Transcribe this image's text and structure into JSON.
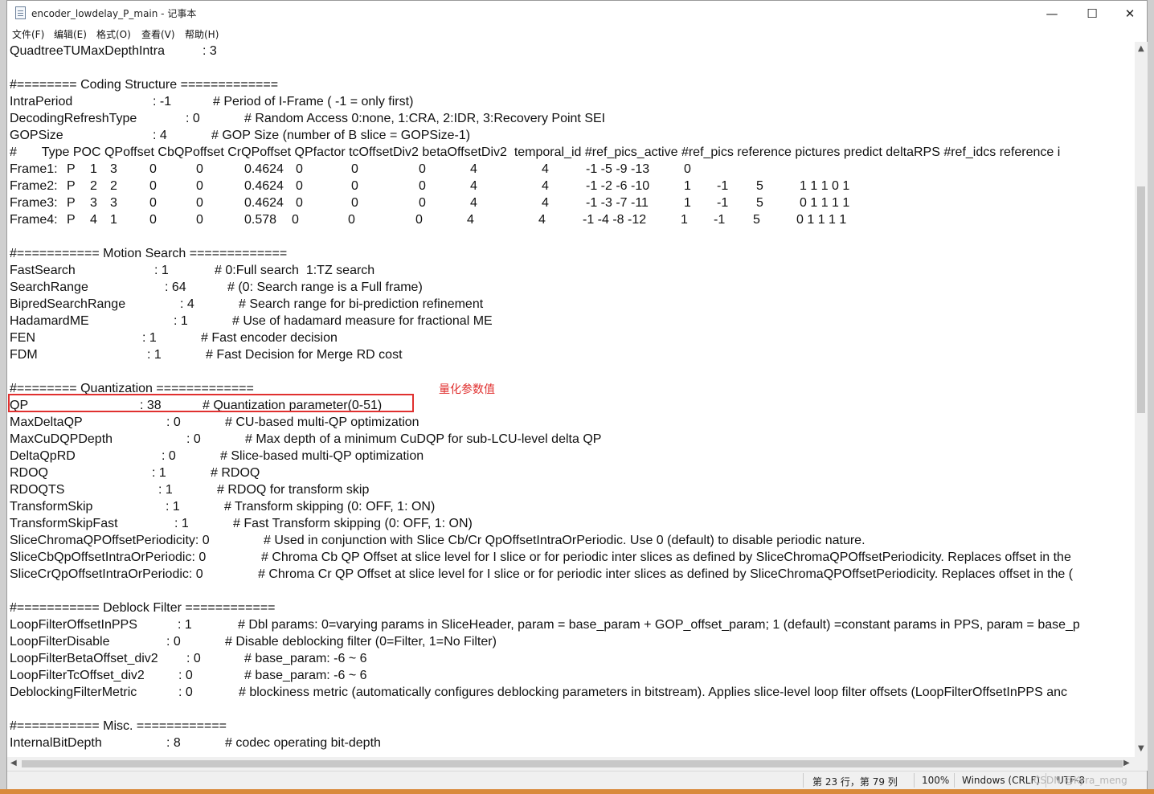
{
  "window": {
    "title": "encoder_lowdelay_P_main - 记事本",
    "minimize_glyph": "—",
    "maximize_glyph": "☐",
    "close_glyph": "✕"
  },
  "menu": [
    "文件(F)",
    "编辑(E)",
    "格式(O)",
    "查看(V)",
    "帮助(H)"
  ],
  "annotation": {
    "text": "量化参数值",
    "color": "#e0302f"
  },
  "lines": [
    [
      [
        0,
        "QuadtreeTUMaxDepthIntra"
      ],
      [
        240,
        ": 3"
      ]
    ],
    [],
    [
      [
        0,
        "#======== Coding Structure ============="
      ]
    ],
    [
      [
        0,
        "IntraPeriod"
      ],
      [
        178,
        ": -1"
      ],
      [
        253,
        "# Period of I-Frame ( -1 = only first)"
      ]
    ],
    [
      [
        0,
        "DecodingRefreshType"
      ],
      [
        219,
        ": 0"
      ],
      [
        292,
        "# Random Access 0:none, 1:CRA, 2:IDR, 3:Recovery Point SEI"
      ]
    ],
    [
      [
        0,
        "GOPSize"
      ],
      [
        178,
        ": 4"
      ],
      [
        251,
        "# GOP Size (number of B slice = GOPSize-1)"
      ]
    ],
    [
      [
        0,
        "#       Type POC QPoffset CbQPoffset CrQPoffset QPfactor tcOffsetDiv2 betaOffsetDiv2  temporal_id #ref_pics_active #ref_pics reference pictures predict deltaRPS #ref_idcs reference i"
      ]
    ],
    [
      [
        0,
        "Frame1:"
      ],
      [
        71,
        "P"
      ],
      [
        100,
        "1"
      ],
      [
        125,
        "3"
      ],
      [
        174,
        "0"
      ],
      [
        232,
        "0"
      ],
      [
        292,
        "0.4624"
      ],
      [
        356,
        "0"
      ],
      [
        425,
        "0"
      ],
      [
        509,
        "0"
      ],
      [
        573,
        "4"
      ],
      [
        662,
        "4"
      ],
      [
        717,
        "-1 -5 -9 -13"
      ],
      [
        839,
        "0"
      ]
    ],
    [
      [
        0,
        "Frame2:"
      ],
      [
        71,
        "P"
      ],
      [
        100,
        "2"
      ],
      [
        125,
        "2"
      ],
      [
        174,
        "0"
      ],
      [
        232,
        "0"
      ],
      [
        292,
        "0.4624"
      ],
      [
        356,
        "0"
      ],
      [
        425,
        "0"
      ],
      [
        509,
        "0"
      ],
      [
        573,
        "4"
      ],
      [
        662,
        "4"
      ],
      [
        717,
        "-1 -2 -6 -10"
      ],
      [
        839,
        "1"
      ],
      [
        880,
        "-1"
      ],
      [
        929,
        "5"
      ],
      [
        983,
        "1 1 1 0 1"
      ]
    ],
    [
      [
        0,
        "Frame3:"
      ],
      [
        71,
        "P"
      ],
      [
        100,
        "3"
      ],
      [
        125,
        "3"
      ],
      [
        174,
        "0"
      ],
      [
        232,
        "0"
      ],
      [
        292,
        "0.4624"
      ],
      [
        356,
        "0"
      ],
      [
        425,
        "0"
      ],
      [
        509,
        "0"
      ],
      [
        573,
        "4"
      ],
      [
        662,
        "4"
      ],
      [
        717,
        "-1 -3 -7 -11"
      ],
      [
        839,
        "1"
      ],
      [
        880,
        "-1"
      ],
      [
        929,
        "5"
      ],
      [
        983,
        "0 1 1 1 1"
      ]
    ],
    [
      [
        0,
        "Frame4:"
      ],
      [
        71,
        "P"
      ],
      [
        100,
        "4"
      ],
      [
        125,
        "1"
      ],
      [
        174,
        "0"
      ],
      [
        232,
        "0"
      ],
      [
        292,
        "0.578"
      ],
      [
        351,
        "0"
      ],
      [
        421,
        "0"
      ],
      [
        505,
        "0"
      ],
      [
        569,
        "4"
      ],
      [
        658,
        "4"
      ],
      [
        713,
        "-1 -4 -8 -12"
      ],
      [
        835,
        "1"
      ],
      [
        876,
        "-1"
      ],
      [
        925,
        "5"
      ],
      [
        979,
        "0 1 1 1 1"
      ]
    ],
    [],
    [
      [
        0,
        "#=========== Motion Search ============="
      ]
    ],
    [
      [
        0,
        "FastSearch"
      ],
      [
        180,
        ": 1"
      ],
      [
        255,
        "# 0:Full search  1:TZ search"
      ]
    ],
    [
      [
        0,
        "SearchRange"
      ],
      [
        193,
        ": 64"
      ],
      [
        271,
        "# (0: Search range is a Full frame)"
      ]
    ],
    [
      [
        0,
        "BipredSearchRange"
      ],
      [
        212,
        ": 4"
      ],
      [
        285,
        "# Search range for bi-prediction refinement"
      ]
    ],
    [
      [
        0,
        "HadamardME"
      ],
      [
        204,
        ": 1"
      ],
      [
        277,
        "# Use of hadamard measure for fractional ME"
      ]
    ],
    [
      [
        0,
        "FEN"
      ],
      [
        165,
        ": 1"
      ],
      [
        238,
        "# Fast encoder decision"
      ]
    ],
    [
      [
        0,
        "FDM"
      ],
      [
        171,
        ": 1"
      ],
      [
        244,
        "# Fast Decision for Merge RD cost"
      ]
    ],
    [],
    [
      [
        0,
        "#======== Quantization ============="
      ]
    ],
    [
      [
        0,
        "QP"
      ],
      [
        162,
        ": 38"
      ],
      [
        240,
        "# Quantization parameter(0-51)"
      ]
    ],
    [
      [
        0,
        "MaxDeltaQP"
      ],
      [
        195,
        ": 0"
      ],
      [
        268,
        "# CU-based multi-QP optimization"
      ]
    ],
    [
      [
        0,
        "MaxCuDQPDepth"
      ],
      [
        220,
        ": 0"
      ],
      [
        293,
        "# Max depth of a minimum CuDQP for sub-LCU-level delta QP"
      ]
    ],
    [
      [
        0,
        "DeltaQpRD"
      ],
      [
        189,
        ": 0"
      ],
      [
        262,
        "# Slice-based multi-QP optimization"
      ]
    ],
    [
      [
        0,
        "RDOQ"
      ],
      [
        177,
        ": 1"
      ],
      [
        250,
        "# RDOQ"
      ]
    ],
    [
      [
        0,
        "RDOQTS"
      ],
      [
        185,
        ": 1"
      ],
      [
        258,
        "# RDOQ for transform skip"
      ]
    ],
    [
      [
        0,
        "TransformSkip"
      ],
      [
        194,
        ": 1"
      ],
      [
        267,
        "# Transform skipping (0: OFF, 1: ON)"
      ]
    ],
    [
      [
        0,
        "TransformSkipFast"
      ],
      [
        205,
        ": 1"
      ],
      [
        278,
        "# Fast Transform skipping (0: OFF, 1: ON)"
      ]
    ],
    [
      [
        0,
        "SliceChromaQPOffsetPeriodicity: 0"
      ],
      [
        316,
        "# Used in conjunction with Slice Cb/Cr QpOffsetIntraOrPeriodic. Use 0 (default) to disable periodic nature."
      ]
    ],
    [
      [
        0,
        "SliceCbQpOffsetIntraOrPeriodic: 0"
      ],
      [
        313,
        "# Chroma Cb QP Offset at slice level for I slice or for periodic inter slices as defined by SliceChromaQPOffsetPeriodicity. Replaces offset in the"
      ]
    ],
    [
      [
        0,
        "SliceCrQpOffsetIntraOrPeriodic: 0"
      ],
      [
        309,
        "# Chroma Cr QP Offset at slice level for I slice or for periodic inter slices as defined by SliceChromaQPOffsetPeriodicity. Replaces offset in the ("
      ]
    ],
    [],
    [
      [
        0,
        "#=========== Deblock Filter ============"
      ]
    ],
    [
      [
        0,
        "LoopFilterOffsetInPPS"
      ],
      [
        209,
        ": 1"
      ],
      [
        284,
        "# Dbl params: 0=varying params in SliceHeader, param = base_param + GOP_offset_param; 1 (default) =constant params in PPS, param = base_p"
      ]
    ],
    [
      [
        0,
        "LoopFilterDisable"
      ],
      [
        195,
        ": 0"
      ],
      [
        268,
        "# Disable deblocking filter (0=Filter, 1=No Filter)"
      ]
    ],
    [
      [
        0,
        "LoopFilterBetaOffset_div2"
      ],
      [
        220,
        ": 0"
      ],
      [
        292,
        "# base_param: -6 ~ 6"
      ]
    ],
    [
      [
        0,
        "LoopFilterTcOffset_div2"
      ],
      [
        210,
        ": 0"
      ],
      [
        292,
        "# base_param: -6 ~ 6"
      ]
    ],
    [
      [
        0,
        "DeblockingFilterMetric"
      ],
      [
        210,
        ": 0"
      ],
      [
        285,
        "# blockiness metric (automatically configures deblocking parameters in bitstream). Applies slice-level loop filter offsets (LoopFilterOffsetInPPS anc"
      ]
    ],
    [],
    [
      [
        0,
        "#=========== Misc. ============"
      ]
    ],
    [
      [
        0,
        "InternalBitDepth"
      ],
      [
        195,
        ": 8"
      ],
      [
        268,
        "# codec operating bit-depth"
      ]
    ]
  ],
  "status": {
    "position": "第 23 行，第 79 列",
    "zoom": "100%",
    "line_ending": "Windows (CRLF)",
    "encoding": "UTF-8"
  },
  "watermark": "CSDN @Kyra_meng"
}
